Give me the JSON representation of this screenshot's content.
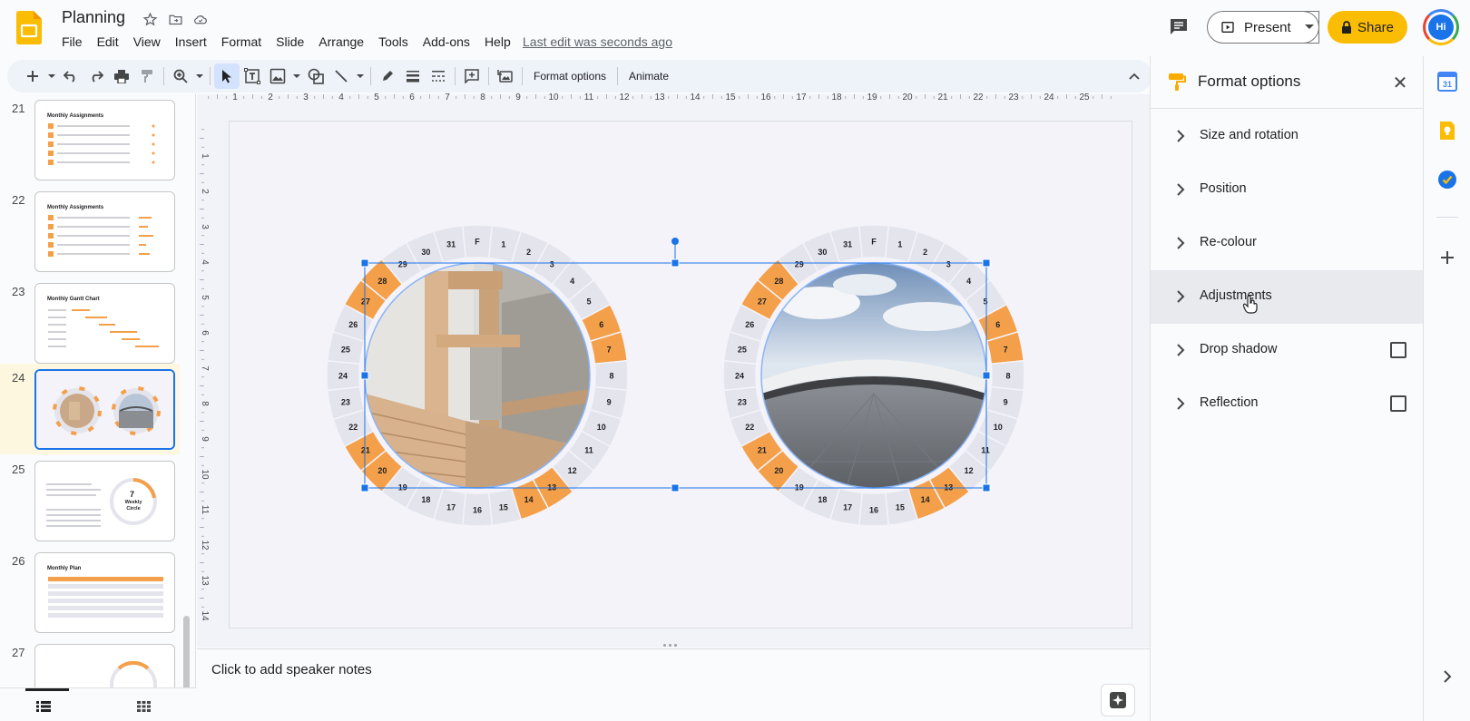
{
  "header": {
    "title": "Planning",
    "menu": [
      "File",
      "Edit",
      "View",
      "Insert",
      "Format",
      "Slide",
      "Arrange",
      "Tools",
      "Add-ons",
      "Help"
    ],
    "last_edit": "Last edit was seconds ago",
    "present_label": "Present",
    "share_label": "Share",
    "avatar_initials": "Hi"
  },
  "toolbar": {
    "format_options_label": "Format options",
    "animate_label": "Animate"
  },
  "filmstrip": {
    "slides": [
      {
        "number": "21",
        "title": "Monthly Assignments"
      },
      {
        "number": "22",
        "title": "Monthly Assignments"
      },
      {
        "number": "23",
        "title": "Monthly Gantt Chart"
      },
      {
        "number": "24",
        "title": ""
      },
      {
        "number": "25",
        "title": "Weekly Circle",
        "badge": "7"
      },
      {
        "number": "26",
        "title": "Monthly Plan"
      },
      {
        "number": "27",
        "title": ""
      }
    ]
  },
  "ruler": {
    "top": [
      "1",
      "2",
      "3",
      "4",
      "5",
      "6",
      "7",
      "8",
      "9",
      "10",
      "11",
      "12",
      "13",
      "14",
      "15",
      "16",
      "17",
      "18",
      "19",
      "20",
      "21",
      "22",
      "23",
      "24",
      "25"
    ],
    "left": [
      "1",
      "2",
      "3",
      "4",
      "5",
      "6",
      "7",
      "8",
      "9",
      "10",
      "11",
      "12",
      "13",
      "14"
    ]
  },
  "wheel": {
    "labels": [
      "F",
      "1",
      "2",
      "3",
      "4",
      "5",
      "6",
      "7",
      "8",
      "9",
      "10",
      "11",
      "12",
      "13",
      "14",
      "15",
      "16",
      "17",
      "18",
      "19",
      "20",
      "21",
      "22",
      "23",
      "24",
      "25",
      "26",
      "27",
      "28",
      "29",
      "30",
      "31"
    ],
    "highlighted": [
      "6",
      "7",
      "13",
      "14",
      "20",
      "21",
      "27",
      "28"
    ],
    "colors": {
      "orange": "#f4a04a",
      "gray": "#e4e4ec",
      "outline": "#8ab4f8",
      "selection": "#1a73e8"
    }
  },
  "notes": {
    "placeholder": "Click to add speaker notes"
  },
  "format_panel": {
    "title": "Format options",
    "items": [
      {
        "label": "Size and rotation",
        "checkbox": false
      },
      {
        "label": "Position",
        "checkbox": false
      },
      {
        "label": "Re-colour",
        "checkbox": false
      },
      {
        "label": "Adjustments",
        "checkbox": false
      },
      {
        "label": "Drop shadow",
        "checkbox": true
      },
      {
        "label": "Reflection",
        "checkbox": true
      }
    ]
  },
  "icons": {
    "star": "star-icon",
    "folder": "move-folder-icon",
    "cloud": "cloud-status-icon"
  }
}
